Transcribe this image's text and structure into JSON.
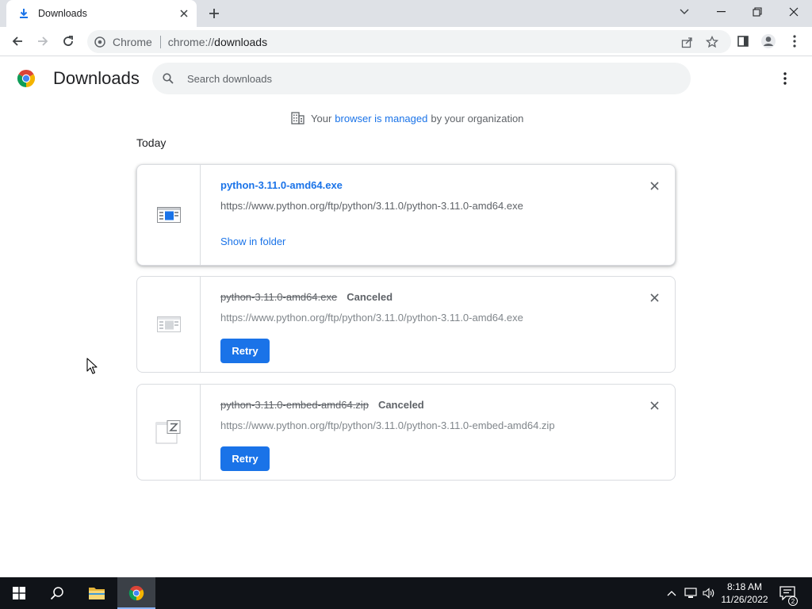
{
  "browser": {
    "tab_title": "Downloads",
    "omnibox_chip": "Chrome",
    "url_scheme": "chrome://",
    "url_host": "downloads",
    "accent_color": "#1a73e8"
  },
  "page": {
    "title": "Downloads",
    "search_placeholder": "Search downloads",
    "managed_prefix": "Your",
    "managed_link": "browser is managed",
    "managed_suffix": "by your organization",
    "section_label": "Today"
  },
  "downloads": [
    {
      "file_name": "python-3.11.0-amd64.exe",
      "url": "https://www.python.org/ftp/python/3.11.0/python-3.11.0-amd64.exe",
      "action": "Show in folder",
      "state": "complete",
      "icon": "exe-file-icon"
    },
    {
      "file_name": "python-3.11.0-amd64.exe",
      "status": "Canceled",
      "url": "https://www.python.org/ftp/python/3.11.0/python-3.11.0-amd64.exe",
      "action": "Retry",
      "state": "canceled",
      "icon": "exe-file-icon"
    },
    {
      "file_name": "python-3.11.0-embed-amd64.zip",
      "status": "Canceled",
      "url": "https://www.python.org/ftp/python/3.11.0/python-3.11.0-embed-amd64.zip",
      "action": "Retry",
      "state": "canceled",
      "icon": "zip-file-icon"
    }
  ],
  "taskbar": {
    "time": "8:18 AM",
    "date": "11/26/2022",
    "notification_count": "2"
  }
}
